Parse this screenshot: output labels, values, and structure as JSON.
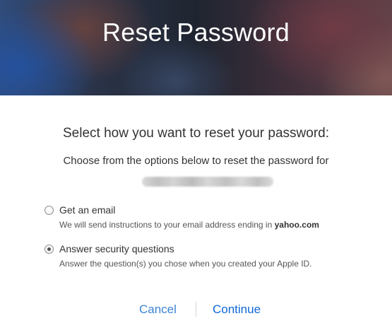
{
  "hero": {
    "title": "Reset Password"
  },
  "content": {
    "prompt": "Select how you want to reset your password:",
    "subprompt": "Choose from the options below to reset the password for"
  },
  "options": [
    {
      "label": "Get an email",
      "description_prefix": "We will send instructions to your email address ending in ",
      "description_emphasis": "yahoo.com",
      "selected": false
    },
    {
      "label": "Answer security questions",
      "description": "Answer the question(s) you chose when you created your Apple ID.",
      "selected": true
    }
  ],
  "actions": {
    "cancel": "Cancel",
    "continue": "Continue"
  },
  "colors": {
    "link": "#3b84d6",
    "primary_link": "#0c68d8",
    "text": "#333333",
    "radio_border": "#8f8f8f"
  }
}
